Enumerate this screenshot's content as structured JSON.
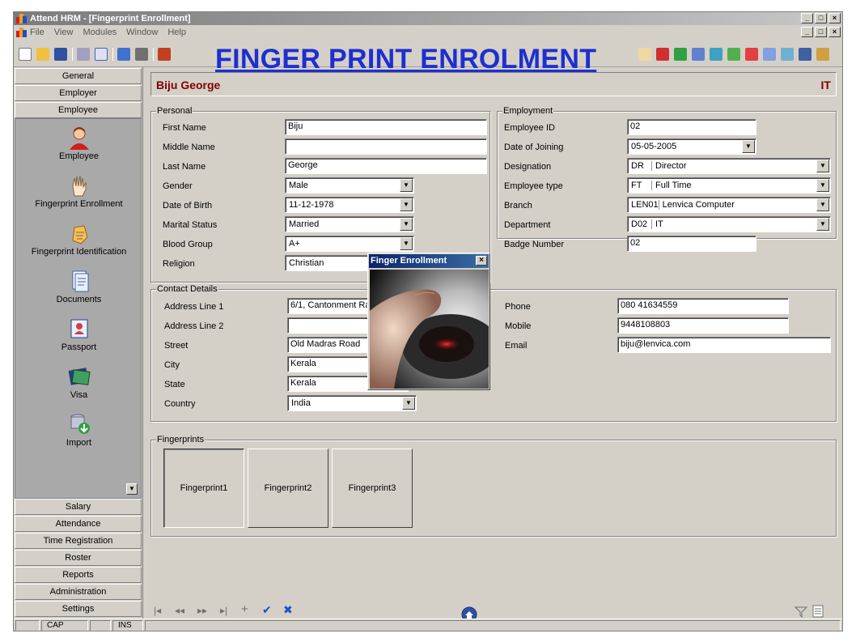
{
  "window": {
    "title": "Attend HRM - [Fingerprint Enrollment]",
    "controls": [
      "_",
      "□",
      "×"
    ]
  },
  "menu": [
    "File",
    "View",
    "Modules",
    "Window",
    "Help"
  ],
  "banner": "FINGER PRINT ENROLMENT",
  "sidebar": {
    "top_buttons": [
      "General",
      "Employer",
      "Employee"
    ],
    "items": [
      {
        "label": "Employee",
        "icon": "employee-icon"
      },
      {
        "label": "Fingerprint Enrollment",
        "icon": "hand-icon"
      },
      {
        "label": "Fingerprint Identification",
        "icon": "fingerprint-id-icon"
      },
      {
        "label": "Documents",
        "icon": "documents-icon"
      },
      {
        "label": "Passport",
        "icon": "passport-icon"
      },
      {
        "label": "Visa",
        "icon": "visa-icon"
      },
      {
        "label": "Import",
        "icon": "import-icon"
      }
    ],
    "bottom_buttons": [
      "Salary",
      "Attendance",
      "Time Registration",
      "Roster",
      "Reports",
      "Administration",
      "Settings"
    ]
  },
  "header": {
    "name": "Biju George",
    "dept": "IT"
  },
  "personal": {
    "title": "Personal",
    "first_name_label": "First Name",
    "first_name": "Biju",
    "middle_name_label": "Middle Name",
    "middle_name": "",
    "last_name_label": "Last Name",
    "last_name": "George",
    "gender_label": "Gender",
    "gender": "Male",
    "dob_label": "Date of Birth",
    "dob": "11-12-1978",
    "marital_label": "Marital Status",
    "marital": "Married",
    "blood_label": "Blood Group",
    "blood": "A+",
    "religion_label": "Religion",
    "religion": "Christian"
  },
  "employment": {
    "title": "Employment",
    "emp_id_label": "Employee ID",
    "emp_id": "02",
    "doj_label": "Date of Joining",
    "doj": "05-05-2005",
    "designation_label": "Designation",
    "designation_code": "DR",
    "designation": "Director",
    "emptype_label": "Employee type",
    "emptype_code": "FT",
    "emptype": "Full Time",
    "branch_label": "Branch",
    "branch_code": "LEN01",
    "branch": "Lenvica Computer",
    "dept_label": "Department",
    "dept_code": "D02",
    "dept": "IT",
    "badge_label": "Badge Number",
    "badge": "02"
  },
  "contact": {
    "title": "Contact Details",
    "addr1_label": "Address Line 1",
    "addr1": "6/1, Cantonment Ra",
    "addr2_label": "Address Line 2",
    "addr2": "",
    "street_label": "Street",
    "street": "Old Madras Road",
    "city_label": "City",
    "city": "Kerala",
    "state_label": "State",
    "state": "Kerala",
    "country_label": "Country",
    "country": "India",
    "phone_label": "Phone",
    "phone": "080 41634559",
    "mobile_label": "Mobile",
    "mobile": "9448108803",
    "email_label": "Email",
    "email": "biju@lenvica.com"
  },
  "fingerprints": {
    "title": "Fingerprints",
    "buttons": [
      "Fingerprint1",
      "Fingerprint2",
      "Fingerprint3"
    ]
  },
  "dialog": {
    "title": "Finger Enrollment",
    "close": "×"
  },
  "navbar": {
    "first": "|◂",
    "prev": "◂◂",
    "next": "▸▸",
    "last": "▸|",
    "add": "+",
    "save": "✔",
    "cancel": "✖"
  },
  "status": {
    "cap": "CAP",
    "ins": "INS"
  },
  "colors": {
    "banner": "#1d2fd0",
    "header_text": "#800000",
    "dialog_title": "#0a246a",
    "accent_blue": "#1a4fd0"
  }
}
